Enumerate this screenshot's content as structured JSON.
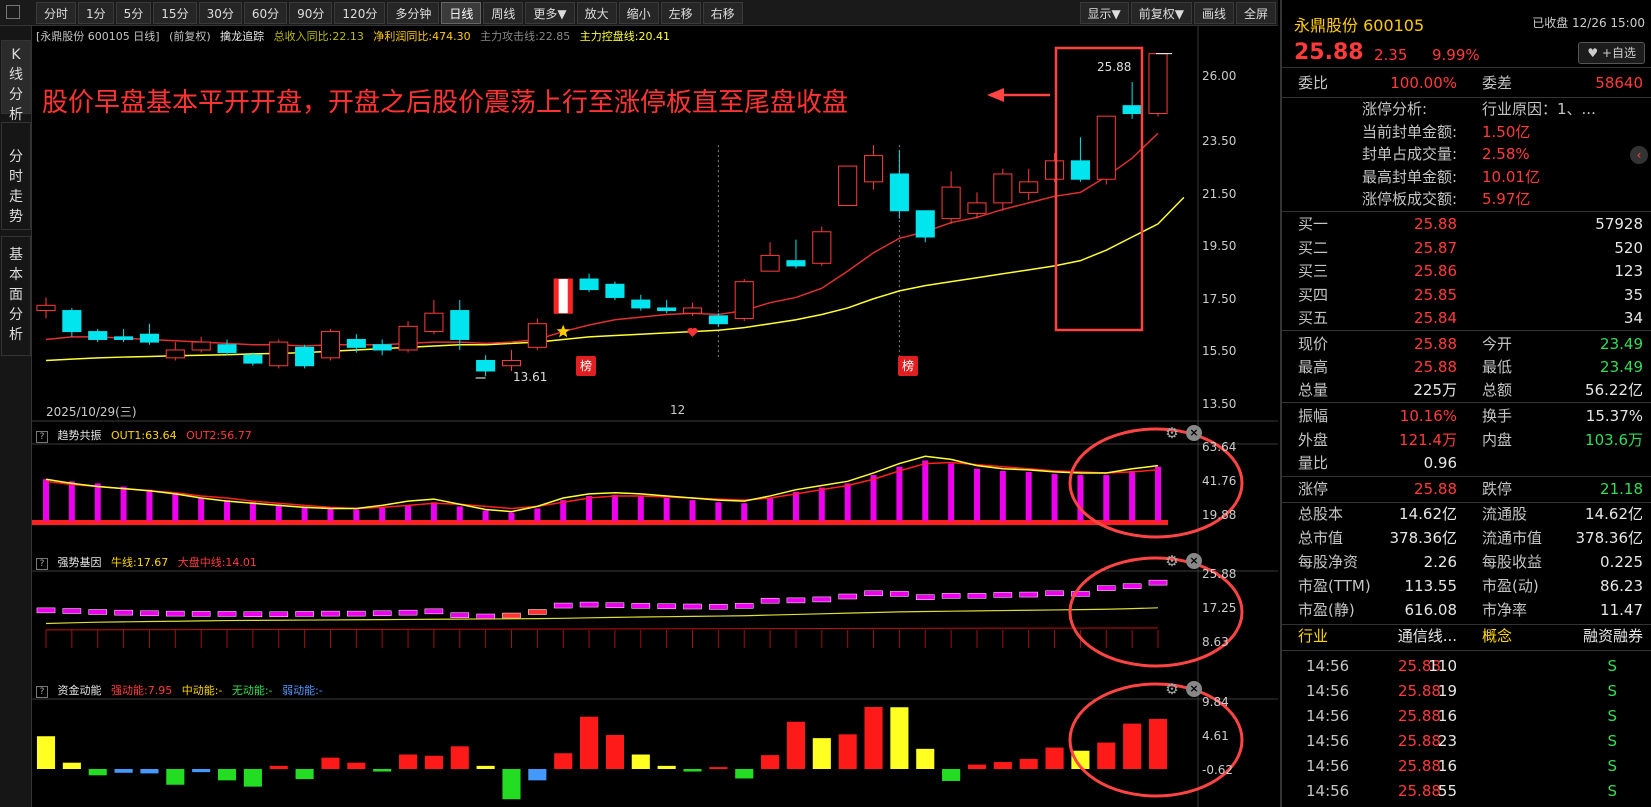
{
  "toolbar": {
    "items": [
      {
        "label": "分时",
        "active": false
      },
      {
        "label": "1分",
        "active": false
      },
      {
        "label": "5分",
        "active": false
      },
      {
        "label": "15分",
        "active": false
      },
      {
        "label": "30分",
        "active": false
      },
      {
        "label": "60分",
        "active": false
      },
      {
        "label": "90分",
        "active": false
      },
      {
        "label": "120分",
        "active": false
      },
      {
        "label": "多分钟",
        "active": false
      },
      {
        "label": "日线",
        "active": true
      },
      {
        "label": "周线",
        "active": false
      },
      {
        "label": "更多▼",
        "active": false
      },
      {
        "label": "放大",
        "active": false
      },
      {
        "label": "缩小",
        "active": false
      },
      {
        "label": "左移",
        "active": false
      },
      {
        "label": "右移",
        "active": false
      }
    ],
    "right_items": [
      "显示▼",
      "前复权▼",
      "画线",
      "全屏"
    ]
  },
  "vtabs": [
    {
      "label": "K线分析",
      "active": true
    },
    {
      "label": "分时走势",
      "active": false
    },
    {
      "label": "基本面分析",
      "active": false
    }
  ],
  "main": {
    "info": {
      "code": "[永鼎股份 600105 日线]",
      "adj": "(前复权)",
      "indicator": "擒龙追踪",
      "v1": "总收入同比:22.13",
      "v2": "净利润同比:474.30",
      "v3": "主力攻击线:22.85",
      "v4": "主力控盘线:20.41"
    },
    "annotation": "股价早盘基本平开开盘，开盘之后股价震荡上行至涨停板直至尾盘收盘",
    "high_label": "25.88",
    "low_label": "13.61",
    "bang_label": "榜",
    "date_label": "2025/10/29(三)",
    "month_label": "12",
    "y_ticks": [
      "26.00",
      "23.50",
      "21.50",
      "19.50",
      "17.50",
      "15.50",
      "13.50"
    ],
    "y_range": [
      13.0,
      26.4
    ],
    "colors": {
      "up": "#ff3b3b",
      "down": "#00e5ee",
      "ma1": "#e03030",
      "ma2": "#ffff33",
      "annotation": "#ff3333"
    }
  },
  "panels": {
    "p1": {
      "name": "趋势共振",
      "out1": "OUT1:63.64",
      "out2": "OUT2:56.77",
      "y_ticks": [
        "63.64",
        "41.76",
        "19.88"
      ]
    },
    "p2": {
      "name": "强势基因",
      "niu": "牛线:17.67",
      "dapan": "大盘中线:14.01",
      "y_ticks": [
        "25.88",
        "17.25",
        "8.63"
      ]
    },
    "p3": {
      "name": "资金动能",
      "strong": "强动能:7.95",
      "mid": "中动能:-",
      "none": "无动能:-",
      "weak": "弱动能:-",
      "y_ticks": [
        "9.84",
        "4.61",
        "-0.62"
      ]
    }
  },
  "chart_data": {
    "type": "candlestick",
    "candles": [
      {
        "o": 16.1,
        "c": 16.3,
        "h": 16.6,
        "l": 15.8
      },
      {
        "o": 16.1,
        "c": 15.3,
        "h": 16.2,
        "l": 15.1
      },
      {
        "o": 15.3,
        "c": 15.0,
        "h": 15.4,
        "l": 14.9
      },
      {
        "o": 15.1,
        "c": 15.0,
        "h": 15.4,
        "l": 14.9
      },
      {
        "o": 15.2,
        "c": 14.9,
        "h": 15.6,
        "l": 14.8
      },
      {
        "o": 14.3,
        "c": 14.6,
        "h": 14.9,
        "l": 14.2
      },
      {
        "o": 14.6,
        "c": 14.9,
        "h": 15.1,
        "l": 14.5
      },
      {
        "o": 14.8,
        "c": 14.5,
        "h": 15.0,
        "l": 14.4
      },
      {
        "o": 14.4,
        "c": 14.1,
        "h": 14.5,
        "l": 14.0
      },
      {
        "o": 14.0,
        "c": 14.9,
        "h": 15.0,
        "l": 13.9
      },
      {
        "o": 14.7,
        "c": 14.0,
        "h": 14.8,
        "l": 13.9
      },
      {
        "o": 14.3,
        "c": 15.3,
        "h": 15.4,
        "l": 14.2
      },
      {
        "o": 15.0,
        "c": 14.7,
        "h": 15.2,
        "l": 14.5
      },
      {
        "o": 14.8,
        "c": 14.6,
        "h": 15.0,
        "l": 14.4
      },
      {
        "o": 14.6,
        "c": 15.5,
        "h": 15.7,
        "l": 14.5
      },
      {
        "o": 15.3,
        "c": 16.0,
        "h": 16.5,
        "l": 15.2
      },
      {
        "o": 16.1,
        "c": 15.0,
        "h": 16.5,
        "l": 14.6
      },
      {
        "o": 14.2,
        "c": 13.8,
        "h": 14.4,
        "l": 13.6
      },
      {
        "o": 14.0,
        "c": 14.2,
        "h": 14.6,
        "l": 13.8
      },
      {
        "o": 14.7,
        "c": 15.6,
        "h": 15.8,
        "l": 14.6
      },
      {
        "o": 16.0,
        "c": 17.3,
        "h": 17.3,
        "l": 16.0
      },
      {
        "o": 17.3,
        "c": 16.9,
        "h": 17.5,
        "l": 16.8
      },
      {
        "o": 17.1,
        "c": 16.6,
        "h": 17.2,
        "l": 16.5
      },
      {
        "o": 16.5,
        "c": 16.2,
        "h": 16.7,
        "l": 16.1
      },
      {
        "o": 16.2,
        "c": 16.1,
        "h": 16.5,
        "l": 16.0
      },
      {
        "o": 16.0,
        "c": 16.2,
        "h": 16.4,
        "l": 15.9
      },
      {
        "o": 15.9,
        "c": 15.6,
        "h": 16.0,
        "l": 15.5
      },
      {
        "o": 15.8,
        "c": 17.2,
        "h": 17.3,
        "l": 15.7
      },
      {
        "o": 17.6,
        "c": 18.2,
        "h": 18.7,
        "l": 17.6
      },
      {
        "o": 18.0,
        "c": 17.8,
        "h": 18.8,
        "l": 17.7
      },
      {
        "o": 17.9,
        "c": 19.1,
        "h": 19.3,
        "l": 17.8
      },
      {
        "o": 20.1,
        "c": 21.6,
        "h": 21.6,
        "l": 20.1
      },
      {
        "o": 21.0,
        "c": 22.0,
        "h": 22.4,
        "l": 20.7
      },
      {
        "o": 21.3,
        "c": 19.9,
        "h": 22.2,
        "l": 19.6
      },
      {
        "o": 19.9,
        "c": 18.9,
        "h": 19.9,
        "l": 18.7
      },
      {
        "o": 19.6,
        "c": 20.8,
        "h": 21.4,
        "l": 19.4
      },
      {
        "o": 19.8,
        "c": 20.2,
        "h": 20.6,
        "l": 19.6
      },
      {
        "o": 20.2,
        "c": 21.3,
        "h": 21.5,
        "l": 19.9
      },
      {
        "o": 20.6,
        "c": 21.0,
        "h": 21.5,
        "l": 20.3
      },
      {
        "o": 21.1,
        "c": 21.8,
        "h": 22.1,
        "l": 21.0
      },
      {
        "o": 21.8,
        "c": 21.1,
        "h": 22.7,
        "l": 21.0
      },
      {
        "o": 21.1,
        "c": 23.5,
        "h": 23.5,
        "l": 20.9
      },
      {
        "o": 23.9,
        "c": 23.6,
        "h": 24.8,
        "l": 23.4
      },
      {
        "o": 23.6,
        "c": 25.88,
        "h": 25.88,
        "l": 23.49
      }
    ],
    "ma_attack": [
      15.0,
      15.1,
      15.1,
      15.05,
      15.0,
      14.95,
      14.9,
      14.85,
      14.8,
      14.8,
      14.75,
      14.8,
      14.8,
      14.8,
      14.85,
      14.9,
      14.9,
      14.85,
      14.9,
      15.0,
      15.3,
      15.55,
      15.75,
      15.85,
      15.95,
      16.0,
      15.95,
      16.1,
      16.4,
      16.6,
      16.95,
      17.6,
      18.3,
      18.85,
      19.1,
      19.45,
      19.65,
      19.95,
      20.2,
      20.45,
      20.6,
      21.2,
      21.9,
      22.85
    ],
    "ma_control": [
      14.2,
      14.25,
      14.3,
      14.33,
      14.35,
      14.38,
      14.4,
      14.42,
      14.45,
      14.47,
      14.5,
      14.55,
      14.6,
      14.65,
      14.7,
      14.75,
      14.8,
      14.8,
      14.85,
      14.9,
      15.0,
      15.1,
      15.15,
      15.2,
      15.25,
      15.3,
      15.35,
      15.45,
      15.6,
      15.75,
      15.95,
      16.2,
      16.55,
      16.85,
      17.05,
      17.2,
      17.35,
      17.5,
      17.65,
      17.8,
      18.0,
      18.4,
      18.9,
      19.4,
      20.41
    ],
    "p1_bars": [
      40,
      38,
      36,
      33,
      30,
      26,
      22,
      20,
      18,
      16,
      14,
      12,
      11,
      13,
      15,
      18,
      14,
      10,
      8,
      12,
      20,
      24,
      25,
      24,
      22,
      20,
      18,
      17,
      22,
      28,
      32,
      36,
      44,
      52,
      58,
      55,
      50,
      48,
      47,
      45,
      44,
      44,
      48,
      52,
      60,
      63.64
    ],
    "p1_out1": [
      40,
      36,
      33,
      31,
      29,
      26,
      22,
      19,
      17,
      15,
      13,
      12,
      12,
      15,
      19,
      21,
      16,
      11,
      9,
      14,
      22,
      26,
      27,
      26,
      24,
      22,
      20,
      19,
      24,
      30,
      34,
      38,
      46,
      55,
      62,
      59,
      53,
      50,
      49,
      47,
      46,
      46,
      50,
      53,
      57,
      63.64
    ],
    "p1_out2": [
      38,
      35,
      33,
      31,
      29,
      27,
      24,
      22,
      19,
      17,
      15,
      13,
      12,
      13,
      15,
      17,
      16,
      14,
      12,
      14,
      18,
      22,
      24,
      24,
      23,
      22,
      21,
      20,
      22,
      26,
      30,
      34,
      40,
      48,
      55,
      56,
      54,
      52,
      50,
      48,
      47,
      46,
      47,
      49,
      52,
      56.77
    ],
    "p2_boxes": [
      16.5,
      16.3,
      16.0,
      15.8,
      15.6,
      15.5,
      15.4,
      15.4,
      15.3,
      15.3,
      15.4,
      15.5,
      15.5,
      15.6,
      15.8,
      16.2,
      15.0,
      14.6,
      14.9,
      16.0,
      18.0,
      18.3,
      18.1,
      17.9,
      17.8,
      17.7,
      17.6,
      17.9,
      19.5,
      19.6,
      19.9,
      20.8,
      21.8,
      21.6,
      20.6,
      21.0,
      21.0,
      21.3,
      21.4,
      21.8,
      21.6,
      23.4,
      24.0,
      25.1,
      25.88
    ],
    "p2_niu": [
      12.6,
      12.8,
      13.0,
      13.1,
      13.2,
      13.3,
      13.4,
      13.5,
      13.55,
      13.6,
      13.65,
      13.7,
      13.75,
      13.8,
      13.85,
      13.9,
      13.95,
      14.0,
      14.05,
      14.1,
      14.2,
      14.35,
      14.5,
      14.6,
      14.7,
      14.8,
      14.9,
      15.0,
      15.2,
      15.4,
      15.6,
      15.8,
      16.0,
      16.2,
      16.3,
      16.4,
      16.5,
      16.6,
      16.7,
      16.8,
      16.9,
      17.0,
      17.2,
      17.45,
      17.67
    ],
    "p3_bars": [
      {
        "v": 5.2,
        "c": "y"
      },
      {
        "v": 1.0,
        "c": "y"
      },
      {
        "v": -1.0,
        "c": "g"
      },
      {
        "v": -0.6,
        "c": "b"
      },
      {
        "v": -0.7,
        "c": "b"
      },
      {
        "v": -2.5,
        "c": "g"
      },
      {
        "v": -0.5,
        "c": "b"
      },
      {
        "v": -1.8,
        "c": "g"
      },
      {
        "v": -2.8,
        "c": "g"
      },
      {
        "v": 0.5,
        "c": "r"
      },
      {
        "v": -1.6,
        "c": "g"
      },
      {
        "v": 1.8,
        "c": "r"
      },
      {
        "v": 1.0,
        "c": "r"
      },
      {
        "v": -0.4,
        "c": "g"
      },
      {
        "v": 2.3,
        "c": "r"
      },
      {
        "v": 2.1,
        "c": "r"
      },
      {
        "v": 3.6,
        "c": "r"
      },
      {
        "v": 0.5,
        "c": "y"
      },
      {
        "v": -4.8,
        "c": "g"
      },
      {
        "v": -1.8,
        "c": "b"
      },
      {
        "v": 2.5,
        "c": "r"
      },
      {
        "v": 8.3,
        "c": "r"
      },
      {
        "v": 5.4,
        "c": "r"
      },
      {
        "v": 2.3,
        "c": "y"
      },
      {
        "v": 0.5,
        "c": "y"
      },
      {
        "v": -0.4,
        "c": "g"
      },
      {
        "v": 0.3,
        "c": "r"
      },
      {
        "v": -1.5,
        "c": "g"
      },
      {
        "v": 2.2,
        "c": "r"
      },
      {
        "v": 7.5,
        "c": "r"
      },
      {
        "v": 4.9,
        "c": "y"
      },
      {
        "v": 5.5,
        "c": "r"
      },
      {
        "v": 9.84,
        "c": "r"
      },
      {
        "v": 9.8,
        "c": "y"
      },
      {
        "v": 3.2,
        "c": "y"
      },
      {
        "v": -1.9,
        "c": "g"
      },
      {
        "v": 0.7,
        "c": "r"
      },
      {
        "v": 1.1,
        "c": "r"
      },
      {
        "v": 1.6,
        "c": "r"
      },
      {
        "v": 3.4,
        "c": "r"
      },
      {
        "v": 2.9,
        "c": "y"
      },
      {
        "v": 4.2,
        "c": "r"
      },
      {
        "v": 7.2,
        "c": "r"
      },
      {
        "v": 7.95,
        "c": "r"
      }
    ]
  },
  "quote": {
    "name": "永鼎股份 600105",
    "status": "已收盘 12/26 15:00",
    "price": "25.88",
    "chg": "2.35",
    "pct": "9.99%",
    "fav": "♥ +自选",
    "weibi_label": "委比",
    "weibi": "100.00%",
    "weicha_label": "委差",
    "weicha": "58640",
    "zt": [
      {
        "label": "涨停分析:",
        "value": "行业原因：1、..."
      },
      {
        "label": "当前封单金额:",
        "value": "1.50亿"
      },
      {
        "label": "封单占成交量:",
        "value": "2.58%"
      },
      {
        "label": "最高封单金额:",
        "value": "10.01亿"
      },
      {
        "label": "涨停板成交额:",
        "value": "5.97亿"
      }
    ],
    "bids": [
      {
        "label": "买一",
        "price": "25.88",
        "vol": "57928"
      },
      {
        "label": "买二",
        "price": "25.87",
        "vol": "520"
      },
      {
        "label": "买三",
        "price": "25.86",
        "vol": "123"
      },
      {
        "label": "买四",
        "price": "25.85",
        "vol": "35"
      },
      {
        "label": "买五",
        "price": "25.84",
        "vol": "34"
      }
    ],
    "stats1": [
      {
        "l1": "现价",
        "v1": "25.88",
        "c1": "red",
        "l2": "今开",
        "v2": "23.49",
        "c2": "green"
      },
      {
        "l1": "最高",
        "v1": "25.88",
        "c1": "red",
        "l2": "最低",
        "v2": "23.49",
        "c2": "green"
      },
      {
        "l1": "总量",
        "v1": "225万",
        "c1": "white",
        "l2": "总额",
        "v2": "56.22亿",
        "c2": "white"
      }
    ],
    "stats2": [
      {
        "l1": "振幅",
        "v1": "10.16%",
        "c1": "red",
        "l2": "换手",
        "v2": "15.37%",
        "c2": "white"
      },
      {
        "l1": "外盘",
        "v1": "121.4万",
        "c1": "red",
        "l2": "内盘",
        "v2": "103.6万",
        "c2": "green"
      },
      {
        "l1": "量比",
        "v1": "0.96",
        "c1": "white",
        "l2": "",
        "v2": "",
        "c2": "white"
      }
    ],
    "limits": {
      "l1": "涨停",
      "v1": "25.88",
      "l2": "跌停",
      "v2": "21.18"
    },
    "fund": [
      {
        "l1": "总股本",
        "v1": "14.62亿",
        "l2": "流通股",
        "v2": "14.62亿"
      },
      {
        "l1": "总市值",
        "v1": "378.36亿",
        "l2": "流通市值",
        "v2": "378.36亿"
      },
      {
        "l1": "每股净资",
        "v1": "2.26",
        "l2": "每股收益",
        "v2": "0.225"
      },
      {
        "l1": "市盈(TTM)",
        "v1": "113.55",
        "l2": "市盈(动)",
        "v2": "86.23"
      },
      {
        "l1": "市盈(静)",
        "v1": "616.08",
        "l2": "市净率",
        "v2": "11.47"
      }
    ],
    "industry": {
      "l1": "行业",
      "v1": "通信线...",
      "l2": "概念",
      "v2": "融资融券"
    },
    "ticks": [
      {
        "t": "14:56",
        "p": "25.88",
        "v": "110",
        "s": "S"
      },
      {
        "t": "14:56",
        "p": "25.88",
        "v": "19",
        "s": "S"
      },
      {
        "t": "14:56",
        "p": "25.88",
        "v": "16",
        "s": "S"
      },
      {
        "t": "14:56",
        "p": "25.88",
        "v": "23",
        "s": "S"
      },
      {
        "t": "14:56",
        "p": "25.88",
        "v": "16",
        "s": "S"
      },
      {
        "t": "14:56",
        "p": "25.88",
        "v": "55",
        "s": "S"
      }
    ]
  }
}
